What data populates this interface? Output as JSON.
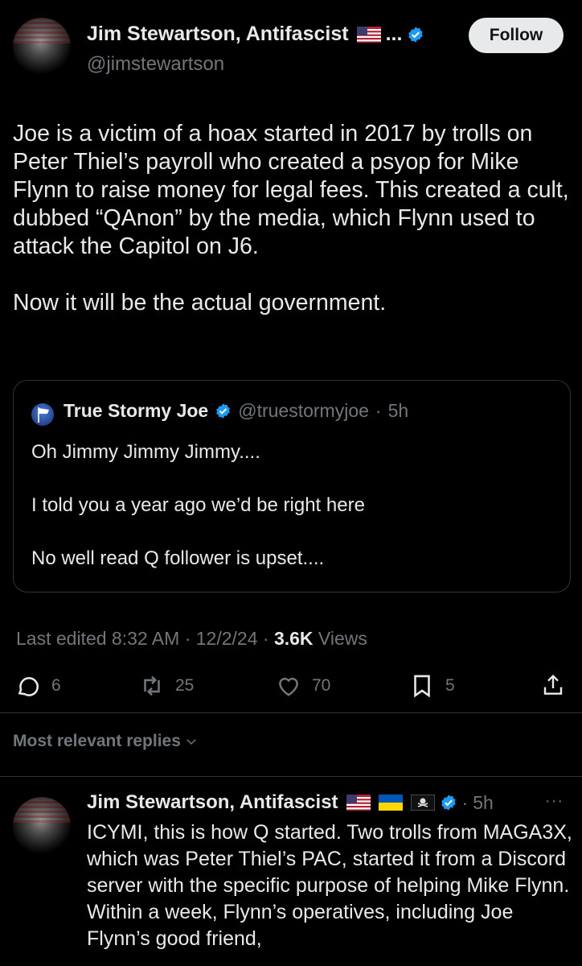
{
  "post": {
    "author_name": "Jim Stewartson, Antifascist",
    "name_suffix": "...",
    "handle": "@jimstewartson",
    "follow_label": "Follow",
    "text": "Joe is a victim of a hoax started in 2017 by trolls on Peter Thiel’s payroll who created a psyop for Mike Flynn to raise money for legal fees. This created a cult, dubbed “QAnon” by the media, which Flynn used to attack the Capitol on J6.\n\nNow it will be the actual government."
  },
  "quote": {
    "author_name": "True Stormy Joe",
    "handle": "@truestormyjoe",
    "separator": "·",
    "time": "5h",
    "lines": [
      "Oh Jimmy Jimmy Jimmy....",
      "I told you a year ago we’d be right here",
      "No well read Q follower is upset...."
    ]
  },
  "meta": {
    "edited": "Last edited 8:32 AM · 12/2/24",
    "dot": "·",
    "views_count": "3.6K",
    "views_label": "Views"
  },
  "actions": {
    "replies": "6",
    "reposts": "25",
    "likes": "70",
    "bookmarks": "5"
  },
  "replies_sort": {
    "label": "Most relevant replies"
  },
  "reply": {
    "author_name": "Jim Stewartson, Antifascist",
    "separator": "·",
    "time": "5h",
    "more": "···",
    "text": "ICYMI, this is how Q started. Two trolls from MAGA3X, which was Peter Thiel’s PAC, started it from a Discord server with the specific purpose of helping Mike Flynn. Within a week, Flynn’s operatives, including Joe Flynn’s good friend,"
  },
  "colors": {
    "background": "#000000",
    "text": "#e7e9ea",
    "muted": "#71767b",
    "verified": "#1d9bf0",
    "border": "#2f3336"
  },
  "icons": [
    "reply-icon",
    "repost-icon",
    "like-icon",
    "bookmark-icon",
    "share-icon",
    "verified-icon",
    "chevron-down-icon",
    "us-flag-icon",
    "ukraine-flag-icon",
    "pirate-flag-icon",
    "more-icon"
  ]
}
